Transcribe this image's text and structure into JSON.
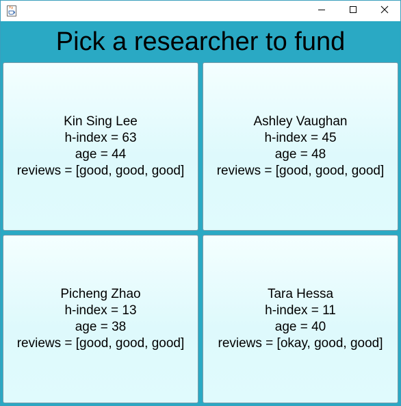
{
  "window": {
    "icon": "java-icon",
    "controls": {
      "minimize_icon": "minimize-icon",
      "maximize_icon": "maximize-icon",
      "close_icon": "close-icon"
    }
  },
  "heading": "Pick a researcher to fund",
  "researchers": [
    {
      "name": "Kin Sing Lee",
      "h_index": "h-index = 63",
      "age": "age = 44",
      "reviews": "reviews = [good, good, good]"
    },
    {
      "name": "Ashley Vaughan",
      "h_index": "h-index = 45",
      "age": "age = 48",
      "reviews": "reviews = [good, good, good]"
    },
    {
      "name": "Picheng Zhao",
      "h_index": "h-index = 13",
      "age": "age = 38",
      "reviews": "reviews = [good, good, good]"
    },
    {
      "name": "Tara Hessa",
      "h_index": "h-index = 11",
      "age": "age = 40",
      "reviews": "reviews = [okay, good, good]"
    }
  ],
  "colors": {
    "background": "#2aa9c4",
    "card_top": "#f4ffff",
    "card_bottom": "#def9fc"
  }
}
